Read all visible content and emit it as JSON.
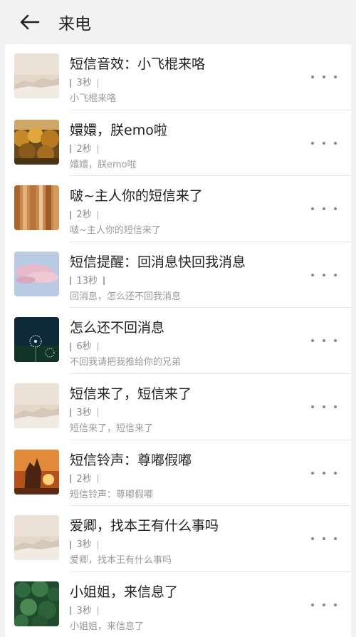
{
  "header": {
    "title": "来电"
  },
  "items": [
    {
      "name": "短信音效：小飞棍来咯",
      "duration": "3秒",
      "subtitle": "小飞棍来咯",
      "thumb": "beige-sky"
    },
    {
      "name": "嬛嬛，朕emo啦",
      "duration": "2秒",
      "subtitle": "嬛嬛，朕emo啦",
      "thumb": "autumn-trees"
    },
    {
      "name": "啵~主人你的短信来了",
      "duration": "2秒",
      "subtitle": "啵~主人你的短信来了",
      "thumb": "wood-grain"
    },
    {
      "name": "短信提醒：回消息快回我消息",
      "duration": "13秒",
      "subtitle": "回消息，怎么还不回我消息",
      "thumb": "pink-cloud"
    },
    {
      "name": "怎么还不回消息",
      "duration": "6秒",
      "subtitle": "不回我请把我推给你的兄弟",
      "thumb": "dandelion-night"
    },
    {
      "name": "短信来了，短信来了",
      "duration": "3秒",
      "subtitle": "短信来了，短信来了",
      "thumb": "beige-sky"
    },
    {
      "name": "短信铃声：尊嘟假嘟",
      "duration": "2秒",
      "subtitle": "短信铃声：尊嘟假嘟",
      "thumb": "sunset-rock"
    },
    {
      "name": "爱卿，找本王有什么事吗",
      "duration": "3秒",
      "subtitle": "爱卿，找本王有什么事吗",
      "thumb": "beige-sky"
    },
    {
      "name": "小姐姐，来信息了",
      "duration": "3秒",
      "subtitle": "小姐姐，来信息了",
      "thumb": "green-forest"
    }
  ]
}
